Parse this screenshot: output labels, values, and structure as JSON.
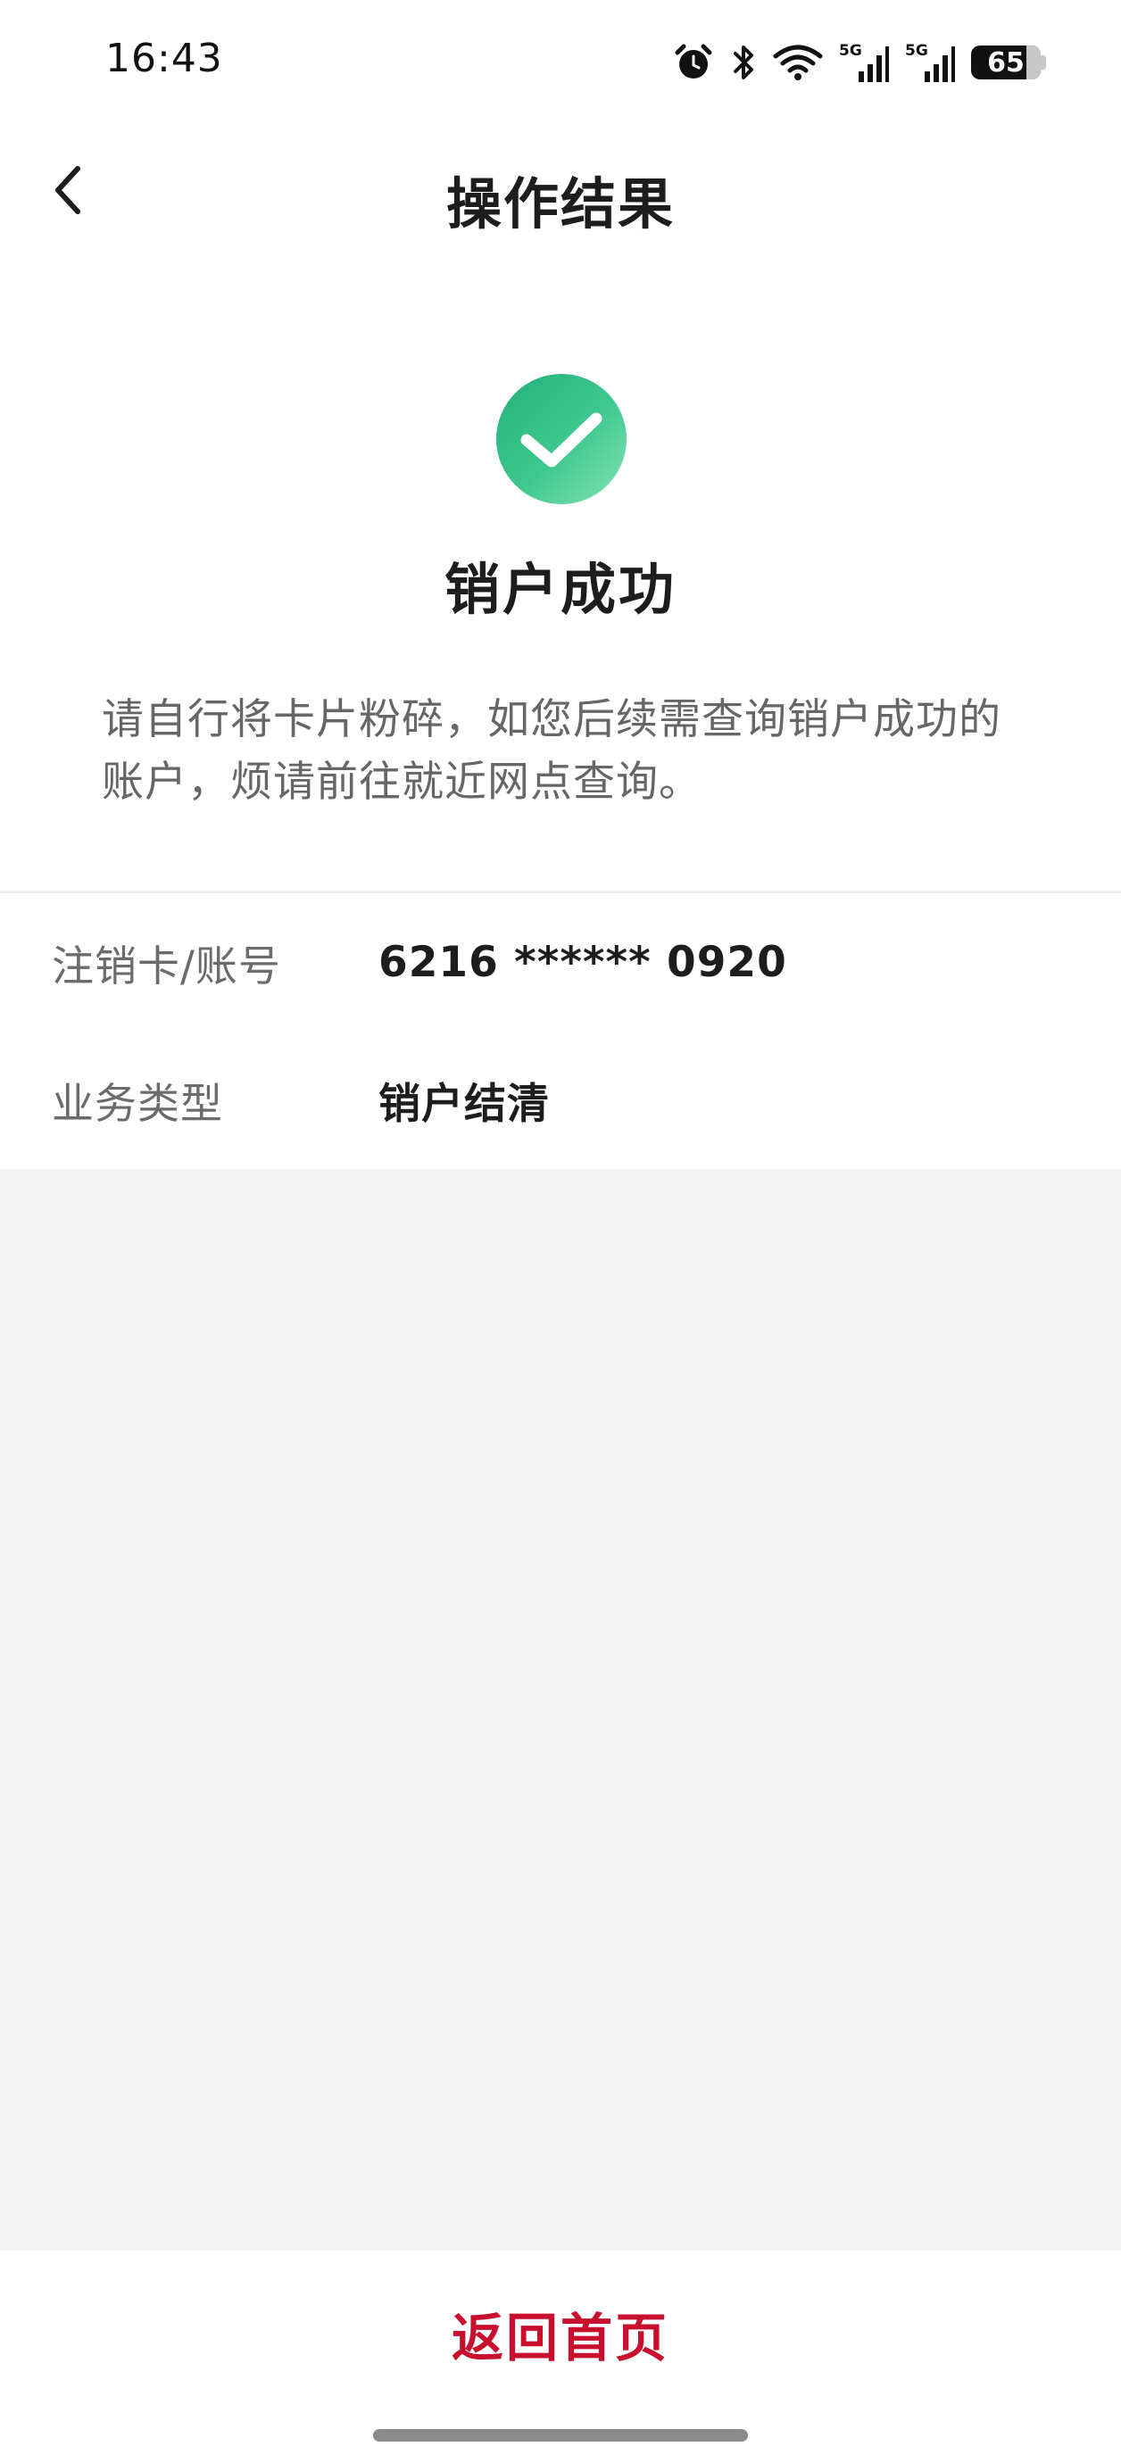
{
  "status_bar": {
    "time": "16:43",
    "battery_level": "65",
    "network_1": "5G",
    "network_2": "5G",
    "icons": [
      "alarm-icon",
      "bluetooth-icon",
      "wifi-icon",
      "signal-5g-icon",
      "signal-5g-icon",
      "battery-icon"
    ]
  },
  "nav": {
    "title": "操作结果",
    "back_icon": "chevron-left-icon"
  },
  "result": {
    "status_icon": "check-circle-icon",
    "title": "销户成功",
    "description": "请自行将卡片粉碎，如您后续需查询销户成功的账户，烦请前往就近网点查询。",
    "accent_color": "#2fbf84"
  },
  "details": [
    {
      "label": "注销卡/账号",
      "value": "6216 ****** 0920"
    },
    {
      "label": "业务类型",
      "value": "销户结清"
    }
  ],
  "footer": {
    "home_button_label": "返回首页",
    "home_button_color": "#c8102e"
  }
}
